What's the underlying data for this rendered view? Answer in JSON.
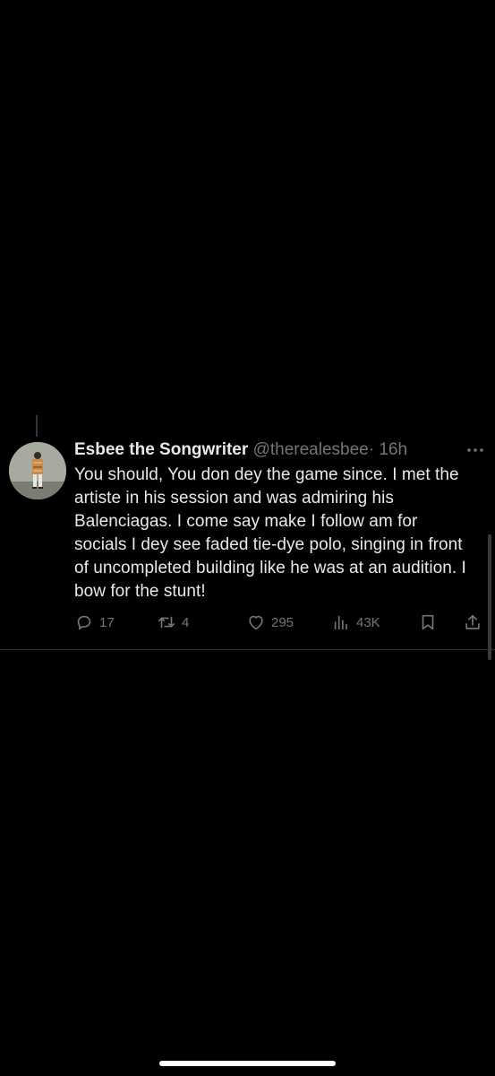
{
  "tweet": {
    "display_name": "Esbee the Songwriter",
    "handle": "@therealesbee",
    "separator": "·",
    "time": "16h",
    "text": "You should, You don dey the game since. I met the artiste in his session and was admiring his Balenciagas. I come say make I follow am for socials I dey see faded tie-dye polo, singing in front of uncompleted building like he was at an audition. I bow for the stunt!",
    "actions": {
      "replies": "17",
      "retweets": "4",
      "likes": "295",
      "views": "43K"
    }
  },
  "icons": {
    "more": "more-horizontal-icon",
    "reply": "reply-icon",
    "retweet": "retweet-icon",
    "like": "heart-icon",
    "views": "views-chart-icon",
    "bookmark": "bookmark-icon",
    "share": "share-icon"
  },
  "colors": {
    "background": "#000000",
    "primary_text": "#e7e9ea",
    "secondary_text": "#71767b",
    "divider": "#2f3336"
  }
}
